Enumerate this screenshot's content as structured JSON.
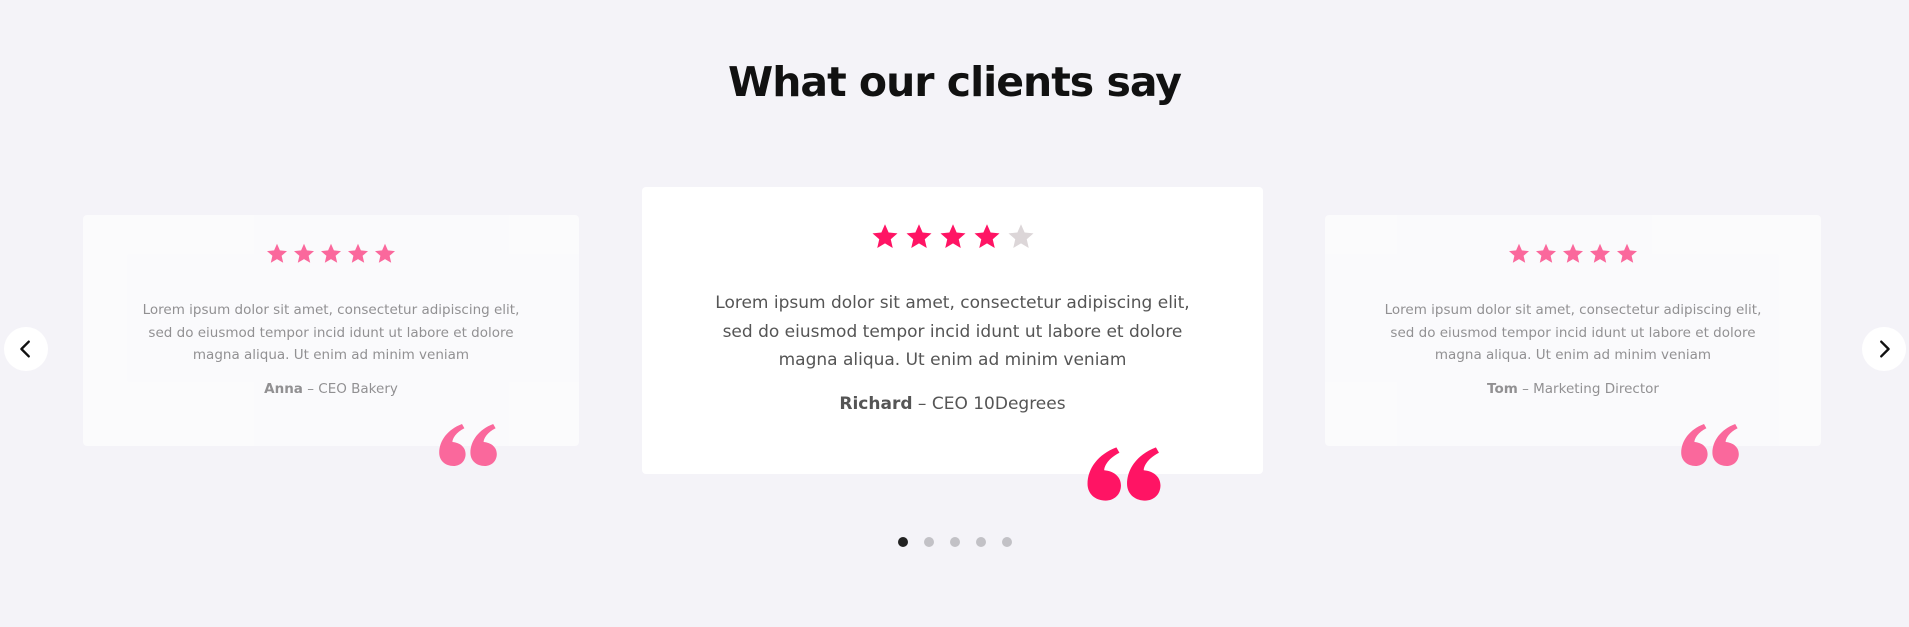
{
  "heading": "What our clients say",
  "colors": {
    "background": "#f4f3f8",
    "accent": "#ff1464",
    "star_empty": "#dcd6d8",
    "heading": "#111111",
    "text": "#555555",
    "dot_active": "#222222",
    "dot_inactive": "#c2c1c6"
  },
  "testimonials": [
    {
      "rating": 5,
      "max_rating": 5,
      "text": "Lorem ipsum dolor sit amet, consectetur adipiscing elit, sed do eiusmod tempor incid idunt ut labore et dolore magna aliqua. Ut enim ad minim veniam",
      "name": "Anna",
      "separator": "–",
      "role": "CEO Bakery",
      "quote_icon": "quote-icon"
    },
    {
      "rating": 4,
      "max_rating": 5,
      "text": "Lorem ipsum dolor sit amet, consectetur adipiscing elit, sed do eiusmod tempor incid idunt ut labore et dolore magna aliqua. Ut enim ad minim veniam",
      "name": "Richard",
      "separator": "–",
      "role": "CEO 10Degrees",
      "quote_icon": "quote-icon"
    },
    {
      "rating": 5,
      "max_rating": 5,
      "text": "Lorem ipsum dolor sit amet, consectetur adipiscing elit, sed do eiusmod tempor incid idunt ut labore et dolore magna aliqua. Ut enim ad minim veniam",
      "name": "Tom",
      "separator": "–",
      "role": "Marketing Director",
      "quote_icon": "quote-icon"
    }
  ],
  "navigation": {
    "prev_icon": "chevron-left-icon",
    "next_icon": "chevron-right-icon"
  },
  "pagination": {
    "count": 5,
    "active_index": 0
  }
}
